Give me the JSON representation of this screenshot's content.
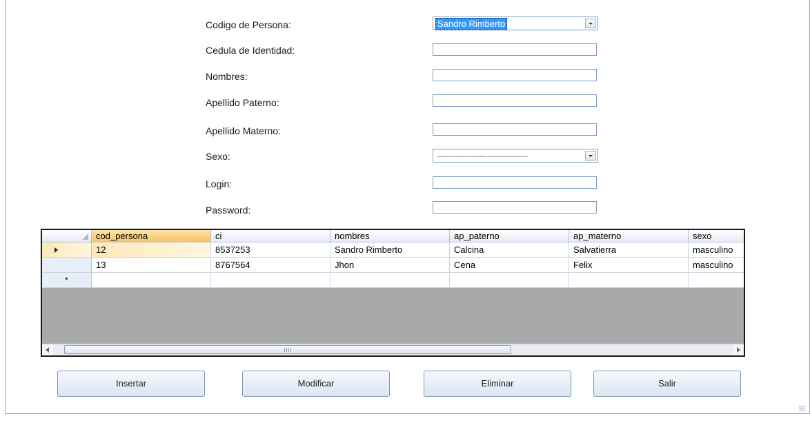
{
  "form": {
    "fields": [
      {
        "label": "Codigo de Persona:",
        "type": "combo",
        "value": "Sandro Rimberto"
      },
      {
        "label": "Cedula de Identidad:",
        "type": "text",
        "value": ""
      },
      {
        "label": "Nombres:",
        "type": "text",
        "value": ""
      },
      {
        "label": "Apellido Paterno:",
        "type": "text",
        "value": ""
      },
      {
        "label": "Apellido Materno:",
        "type": "text",
        "value": ""
      },
      {
        "label": "Sexo:",
        "type": "combo",
        "value": "------------------------------------"
      },
      {
        "label": "Login:",
        "type": "text",
        "value": ""
      },
      {
        "label": "Password:",
        "type": "text",
        "value": ""
      }
    ]
  },
  "grid": {
    "columns": [
      "cod_persona",
      "ci",
      "nombres",
      "ap_paterno",
      "ap_materno",
      "sexo"
    ],
    "rows": [
      [
        "12",
        "8537253",
        "Sandro Rimberto",
        "Calcina",
        "Salvatierra",
        "masculino"
      ],
      [
        "13",
        "8767564",
        "Jhon",
        "Cena",
        "Felix",
        "masculino"
      ]
    ],
    "new_row_marker": "*"
  },
  "buttons": {
    "insertar": "Insertar",
    "modificar": "Modificar",
    "eliminar": "Eliminar",
    "salir": "Salir"
  }
}
